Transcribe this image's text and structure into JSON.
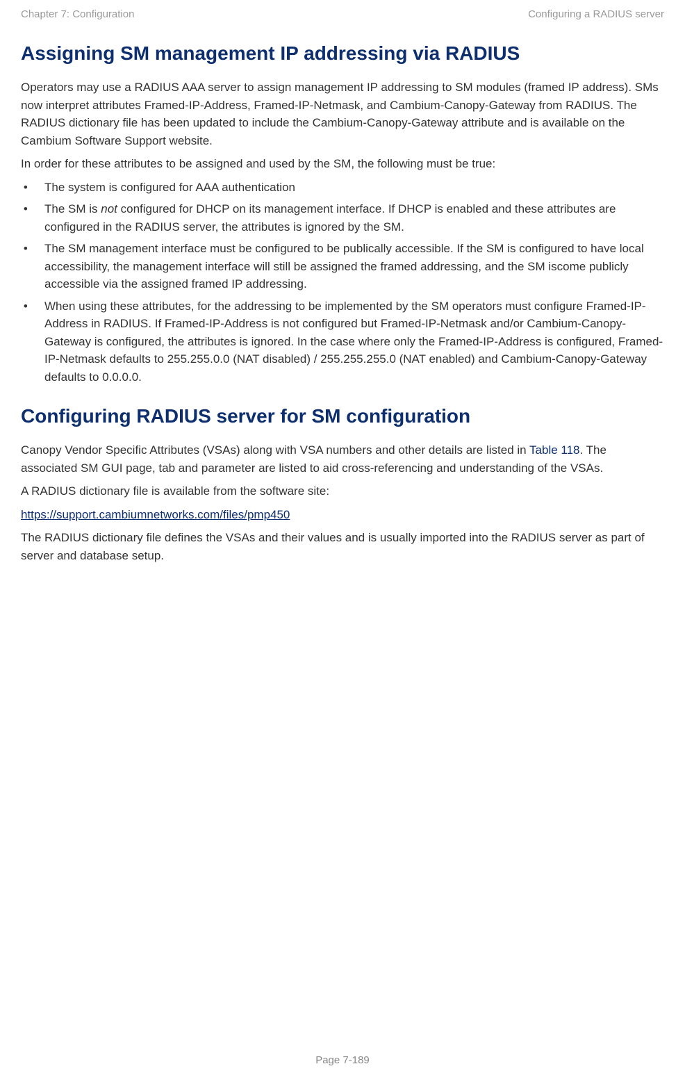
{
  "header": {
    "left": "Chapter 7:  Configuration",
    "right": "Configuring a RADIUS server"
  },
  "section1": {
    "title": "Assigning SM management IP addressing via RADIUS",
    "para1": "Operators may use a RADIUS AAA server to assign management IP addressing to SM modules (framed IP address).  SMs now interpret attributes Framed-IP-Address, Framed-IP-Netmask, and Cambium-Canopy-Gateway from RADIUS.  The RADIUS dictionary file has been updated to include the Cambium-Canopy-Gateway attribute and is available on the Cambium Software Support website.",
    "para2": "In order for these attributes to be assigned and used by the SM, the following must be true:",
    "bullets": [
      {
        "text": "The system is configured for AAA authentication"
      },
      {
        "pre": "The SM is ",
        "italic": "not",
        "post": " configured for DHCP on its management interface.  If DHCP is enabled and these attributes are configured in the RADIUS server, the attributes is ignored by the SM."
      },
      {
        "text": "The SM management interface must be configured to be publically accessible. If the SM is configured to have local accessibility, the management interface will still be assigned the framed addressing, and the SM iscome publicly accessible via the assigned framed IP addressing."
      },
      {
        "text": "When using these attributes, for the addressing to be implemented by the SM operators must configure Framed-IP-Address in RADIUS.  If Framed-IP-Address is not configured but Framed-IP-Netmask and/or Cambium-Canopy-Gateway is configured, the attributes is ignored.  In the case where only the Framed-IP-Address is configured, Framed-IP-Netmask defaults to 255.255.0.0 (NAT disabled) / 255.255.255.0 (NAT enabled) and Cambium-Canopy-Gateway defaults to 0.0.0.0."
      }
    ]
  },
  "section2": {
    "title": "Configuring RADIUS server for SM configuration",
    "para1_pre": "Canopy Vendor Specific Attributes (VSAs) along with VSA numbers and other details are listed in ",
    "para1_ref": "Table 118",
    "para1_post": ". The associated SM GUI page, tab and parameter are listed to aid cross-referencing and understanding of the VSAs.",
    "para2": "A RADIUS dictionary file is available from the software site:",
    "link": "https://support.cambiumnetworks.com/files/pmp450",
    "para3": "The RADIUS dictionary file defines the VSAs and their values and is usually imported into the RADIUS server as part of server and database setup."
  },
  "footer": "Page 7-189"
}
